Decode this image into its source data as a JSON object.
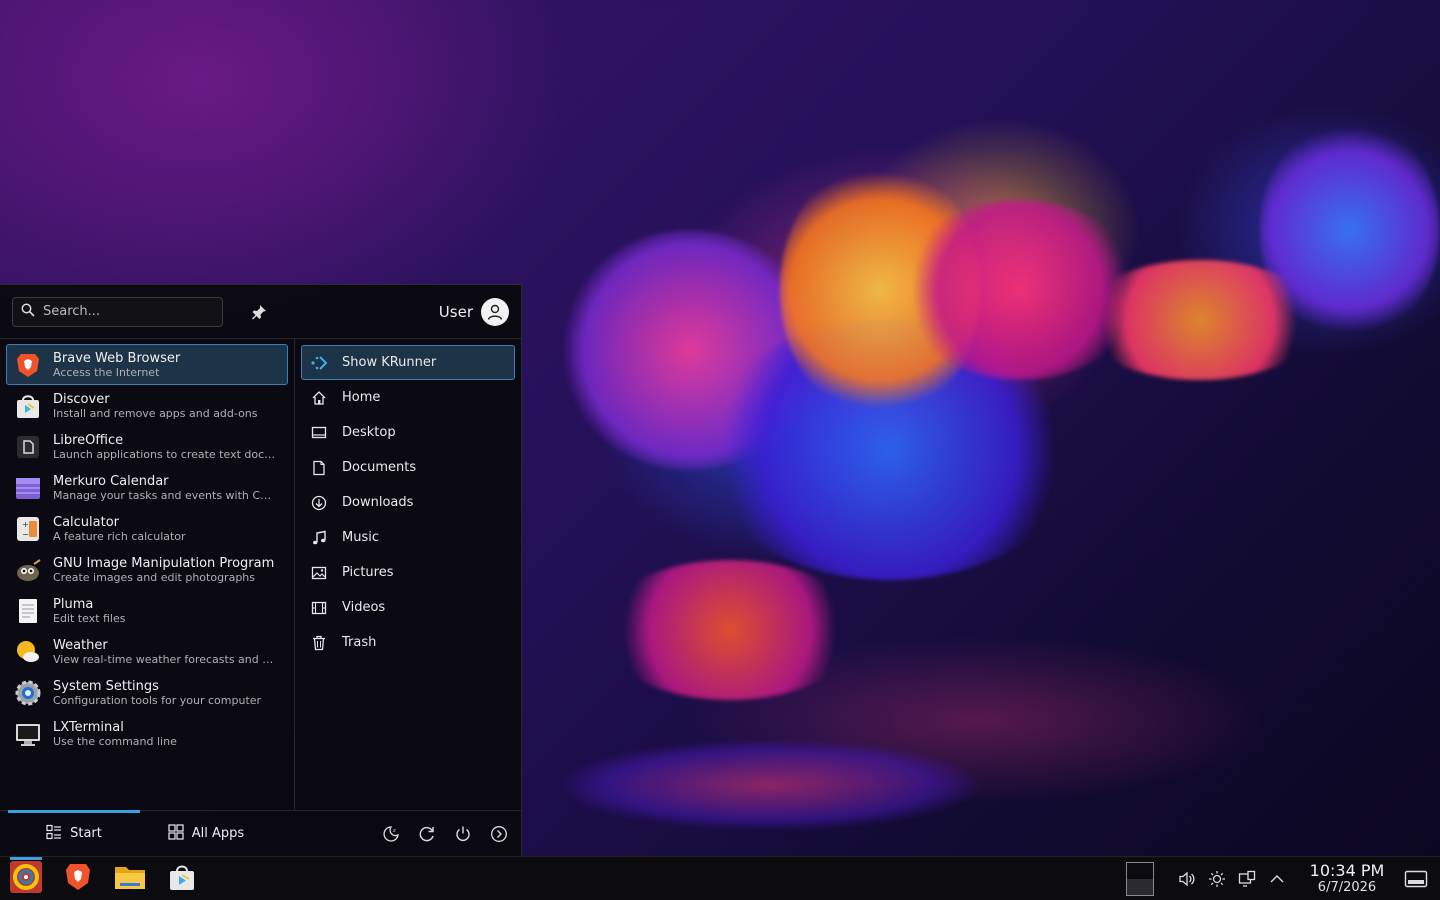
{
  "search": {
    "placeholder": "Search..."
  },
  "user": {
    "name": "User"
  },
  "apps": [
    {
      "name": "Brave Web Browser",
      "desc": "Access the Internet"
    },
    {
      "name": "Discover",
      "desc": "Install and remove apps and add-ons"
    },
    {
      "name": "LibreOffice",
      "desc": "Launch applications to create text docum..."
    },
    {
      "name": "Merkuro Calendar",
      "desc": "Manage your tasks and events with Calen..."
    },
    {
      "name": "Calculator",
      "desc": "A feature rich calculator"
    },
    {
      "name": "GNU Image Manipulation Program",
      "desc": "Create images and edit photographs"
    },
    {
      "name": "Pluma",
      "desc": "Edit text files"
    },
    {
      "name": "Weather",
      "desc": "View real-time weather forecasts and oth..."
    },
    {
      "name": "System Settings",
      "desc": "Configuration tools for your computer"
    },
    {
      "name": "LXTerminal",
      "desc": "Use the command line"
    }
  ],
  "places": [
    {
      "label": "Show KRunner",
      "icon": "krunner-icon"
    },
    {
      "label": "Home",
      "icon": "home-icon"
    },
    {
      "label": "Desktop",
      "icon": "desktop-icon"
    },
    {
      "label": "Documents",
      "icon": "document-icon"
    },
    {
      "label": "Downloads",
      "icon": "download-icon"
    },
    {
      "label": "Music",
      "icon": "music-icon"
    },
    {
      "label": "Pictures",
      "icon": "picture-icon"
    },
    {
      "label": "Videos",
      "icon": "video-icon"
    },
    {
      "label": "Trash",
      "icon": "trash-icon"
    }
  ],
  "footer": {
    "start_label": "Start",
    "all_apps_label": "All Apps"
  },
  "clock": {
    "time": "10:34 PM",
    "date": "6/7/2026"
  },
  "colors": {
    "accent": "#3d9ee0",
    "selection": "#1d3348"
  }
}
